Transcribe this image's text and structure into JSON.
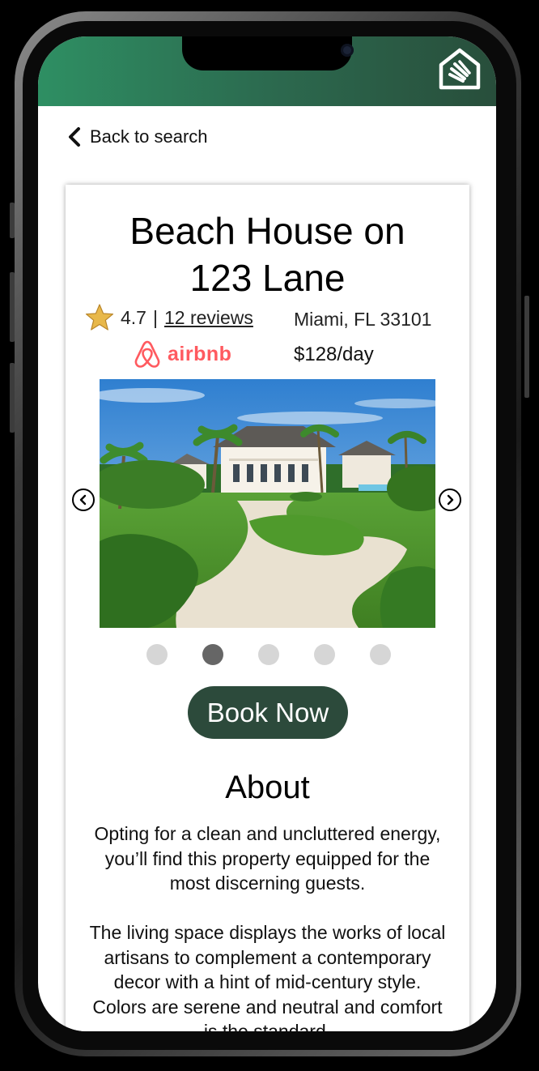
{
  "nav": {
    "back_label": "Back to search"
  },
  "listing": {
    "title_line1": "Beach House on",
    "title_line2": "123 Lane",
    "rating": "4.7",
    "separator": "|",
    "reviews_label": "12 reviews",
    "location": "Miami, FL 33101",
    "source_brand": "airbnb",
    "price": "$128/day"
  },
  "carousel": {
    "slide_count": 5,
    "active_index": 1
  },
  "actions": {
    "book_label": "Book Now"
  },
  "about": {
    "heading": "About",
    "paragraph1": "Opting for a clean and uncluttered energy, you’ll find this property equipped for the most discerning guests.",
    "paragraph2": "The living space displays the works of local artisans to complement a contemporary decor with a hint of mid-century style. Colors are serene and neutral and comfort is the standard."
  },
  "colors": {
    "header_gradient": [
      "#2e8f63",
      "#284e3b"
    ],
    "book_button": "#2c4a3b",
    "airbnb_brand": "#ff5a5f",
    "star": "#e8b84a",
    "dot_active": "#666666",
    "dot_inactive": "#d6d6d6"
  },
  "icons": {
    "app_logo": "house-logo-icon",
    "back": "chevron-left-icon",
    "rating": "star-icon",
    "brand": "airbnb-logo-icon",
    "prev": "chevron-left-circle-icon",
    "next": "chevron-right-circle-icon"
  }
}
